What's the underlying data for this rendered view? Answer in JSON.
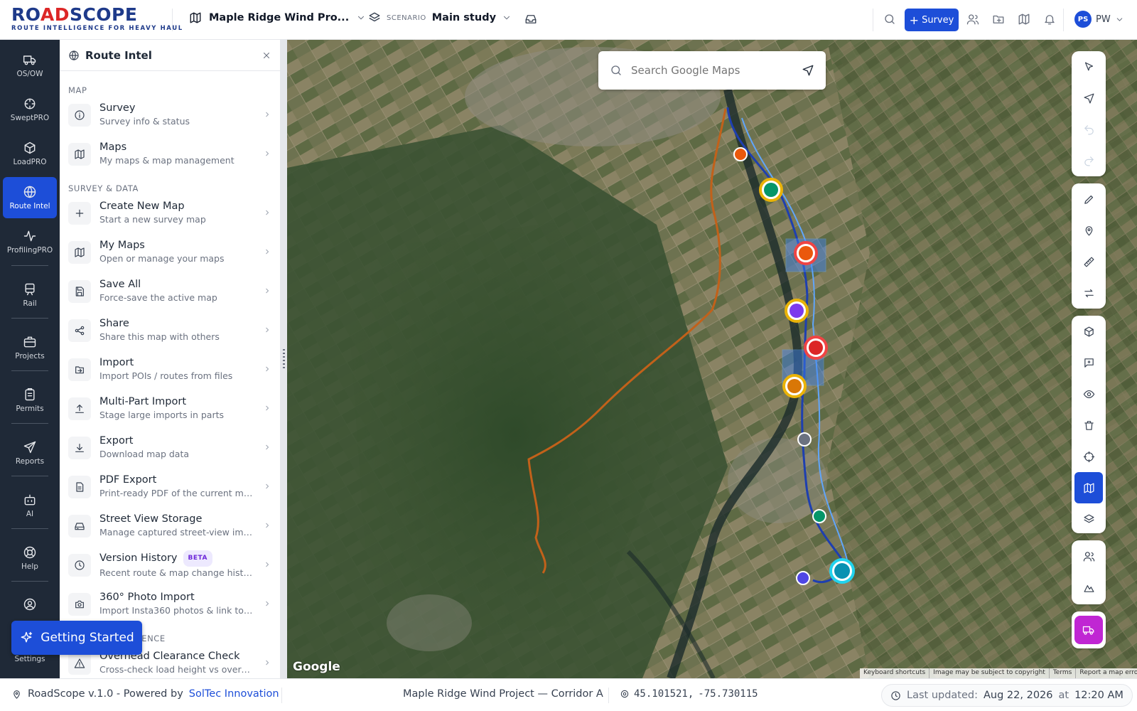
{
  "brand": {
    "name_part1": "RO",
    "name_part2": "AD",
    "name_part3": "SCOPE",
    "tagline": "ROUTE INTELLIGENCE FOR HEAVY HAUL"
  },
  "header": {
    "project": "Maple Ridge Wind Pro...",
    "scenario_label": "SCENARIO",
    "scenario": "Main study",
    "survey_button": "Survey",
    "user_initials": "PS",
    "user_name": "PW"
  },
  "rail": [
    {
      "label": "OS/OW",
      "icon": "truck-icon"
    },
    {
      "label": "SweptPRO",
      "icon": "swept-icon"
    },
    {
      "label": "LoadPRO",
      "icon": "cube-icon"
    },
    {
      "label": "Route Intel",
      "icon": "globe-icon",
      "active": true
    },
    {
      "label": "ProfilingPRO",
      "icon": "pulse-icon"
    },
    {
      "label": "Rail",
      "icon": "train-icon"
    },
    {
      "label": "Projects",
      "icon": "briefcase-icon"
    },
    {
      "label": "Permits",
      "icon": "clipboard-icon"
    },
    {
      "label": "Reports",
      "icon": "send-icon"
    },
    {
      "label": "AI",
      "icon": "bot-icon"
    },
    {
      "label": "Help",
      "icon": "lifebuoy-icon"
    },
    {
      "label": "",
      "icon": "user-circle-icon"
    },
    {
      "label": "Settings",
      "icon": "gear-icon"
    }
  ],
  "panel": {
    "title": "Route Intel",
    "sections": [
      {
        "label": "MAP",
        "items": [
          {
            "title": "Survey",
            "subtitle": "Survey info & status",
            "icon": "info-icon"
          },
          {
            "title": "Maps",
            "subtitle": "My maps & map management",
            "icon": "map-icon"
          }
        ]
      },
      {
        "label": "SURVEY & DATA",
        "items": [
          {
            "title": "Create New Map",
            "subtitle": "Start a new survey map",
            "icon": "plus-icon"
          },
          {
            "title": "My Maps",
            "subtitle": "Open or manage your maps",
            "icon": "map-icon"
          },
          {
            "title": "Save All",
            "subtitle": "Force-save the active map",
            "icon": "save-icon"
          },
          {
            "title": "Share",
            "subtitle": "Share this map with others",
            "icon": "share-icon"
          },
          {
            "title": "Import",
            "subtitle": "Import POIs / routes from files",
            "icon": "import-icon"
          },
          {
            "title": "Multi-Part Import",
            "subtitle": "Stage large imports in parts",
            "icon": "upload-icon"
          },
          {
            "title": "Export",
            "subtitle": "Download map data",
            "icon": "download-icon"
          },
          {
            "title": "PDF Export",
            "subtitle": "Print-ready PDF of the current map",
            "icon": "pdf-icon"
          },
          {
            "title": "Street View Storage",
            "subtitle": "Manage captured street-view imag...",
            "icon": "storage-icon"
          },
          {
            "title": "Version History",
            "subtitle": "Recent route & map change history",
            "icon": "clock-icon",
            "badge": "BETA"
          },
          {
            "title": "360° Photo Import",
            "subtitle": "Import Insta360 photos & link to P...",
            "icon": "camera-icon"
          }
        ]
      },
      {
        "label": "ROUTE INTELLIGENCE",
        "items": [
          {
            "title": "Overhead Clearance Check",
            "subtitle": "Cross-check load height vs overhe...",
            "icon": "warning-icon"
          }
        ]
      }
    ]
  },
  "getting_started": "Getting Started",
  "map": {
    "search_placeholder": "Search Google Maps",
    "google_logo": "Google",
    "attribution": [
      "Keyboard shortcuts",
      "Image may be subject to copyright",
      "Terms",
      "Report a map error"
    ]
  },
  "footer": {
    "version": "RoadScope v.1.0 - Powered by",
    "company": "SolTec Innovation",
    "project": "Maple Ridge Wind Project — Corridor A",
    "lat": "45.101521,",
    "lng": "-75.730115",
    "updated_label": "Last updated:",
    "updated_date": "Aug 22, 2026",
    "at": "at",
    "updated_time": "12:20 AM"
  },
  "colors": {
    "accent": "#1d4ed8",
    "rail_bg": "#1f2937",
    "brand_red": "#dc2626",
    "route_orange": "#c2611a",
    "route_blue": "#2563eb"
  }
}
